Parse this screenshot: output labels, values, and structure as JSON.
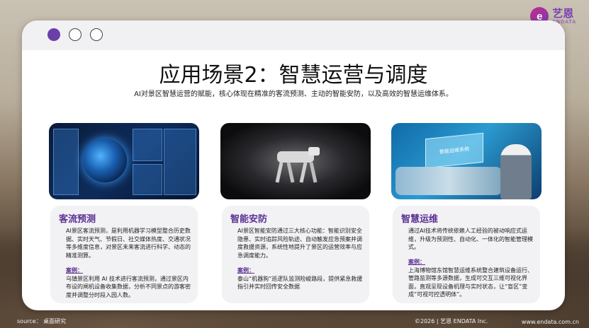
{
  "brand": {
    "logo_letter": "e",
    "name_cn": "艺恩",
    "name_en": "ENDATA"
  },
  "slide": {
    "title": "应用场景2：智慧运营与调度",
    "subtitle": "AI对景区智慧运营的赋能，核心体现在精准的客流预测、主动的智能安防，以及高效的智慧运维体系。"
  },
  "cards": [
    {
      "title": "客流预测",
      "body": "AI景区客流预测，是利用机器学习模型整合历史数据、实时天气、节假日、社交媒体热度、交通状况等多维度信息，对景区未来客流进行科学、动态的精准测算。",
      "case_label": "案例：",
      "case_text": "乌镇景区利用 AI 技术进行客流预测，通过景区内布设的闸机设备收集数据，分析不同景点的游客密度并调整分时段入园人数。"
    },
    {
      "title": "智能安防",
      "body": "AI景区智能安防通过三大核心功能：智能识别安全隐患、实时追踪风险轨迹、自动触发应急预案并调度救援资源，系统性地提升了景区的运营效率与应急调度能力。",
      "case_label": "案例：",
      "case_text": "泰山“机器狗”巡逻队监测险峻路段，提供紧急救援指引并实时回传安全数据"
    },
    {
      "title": "智慧运维",
      "body": "通过AI技术将传统依赖人工经验的被动响应式运维，升级为预测性、自动化、一体化的智能管理模式。",
      "case_label": "案例：",
      "case_text": "上海博物馆东馆智慧运维系统整合建筑设备运行、管路监测等多源数据，生成可交互三维可视化界面，直观呈现设备机理与实时状态，让“盲区”变成“可视可控透明体”。"
    }
  ],
  "images": {
    "img3_holo_text": "智能运维系统"
  },
  "footer": {
    "source": "source： 桌面研究",
    "copyright": "©2026 | 艺恩 ENDATA Inc.",
    "website": "www.endata.com.cn"
  },
  "colors": {
    "accent": "#5a2f93",
    "dot_active": "#6b3fa8"
  }
}
